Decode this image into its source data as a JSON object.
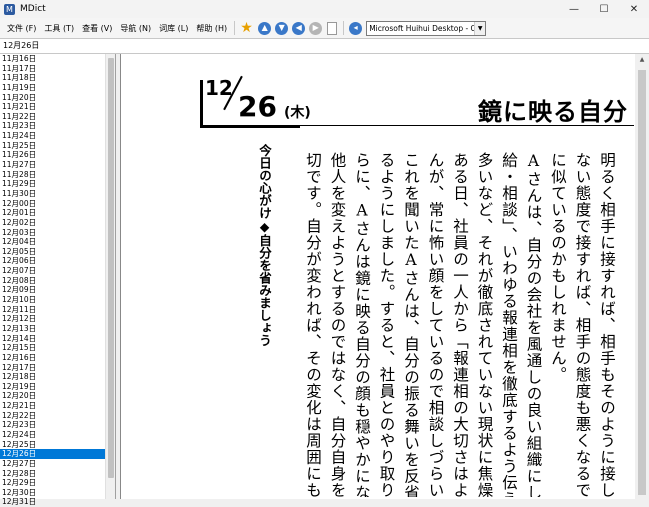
{
  "window": {
    "title": "MDict",
    "minimize": "—",
    "maximize": "☐",
    "close": "✕"
  },
  "menu": [
    {
      "label": "文件",
      "key": "(F)"
    },
    {
      "label": "工具",
      "key": "(T)"
    },
    {
      "label": "查看",
      "key": "(V)"
    },
    {
      "label": "导航",
      "key": "(N)"
    },
    {
      "label": "词库",
      "key": "(L)"
    },
    {
      "label": "帮助",
      "key": "(H)"
    }
  ],
  "toolbar": {
    "star": "★",
    "up": "▲",
    "down": "▼",
    "back": "◀",
    "forward": "▶",
    "font_select": "Microsoft Huihui Desktop - C",
    "font_arrow": "▼"
  },
  "headword": "12月26日",
  "word_list": {
    "items": [
      "11月16日",
      "11月17日",
      "11月18日",
      "11月19日",
      "11月20日",
      "11月21日",
      "11月22日",
      "11月23日",
      "11月24日",
      "11月25日",
      "11月26日",
      "11月27日",
      "11月28日",
      "11月29日",
      "11月30日",
      "12月00日",
      "12月01日",
      "12月02日",
      "12月03日",
      "12月04日",
      "12月05日",
      "12月06日",
      "12月07日",
      "12月08日",
      "12月09日",
      "12月10日",
      "12月11日",
      "12月12日",
      "12月13日",
      "12月14日",
      "12月15日",
      "12月16日",
      "12月17日",
      "12月18日",
      "12月19日",
      "12月20日",
      "12月21日",
      "12月22日",
      "12月23日",
      "12月24日",
      "12月25日",
      "12月26日",
      "12月27日",
      "12月28日",
      "12月29日",
      "12月30日",
      "12月31日"
    ],
    "selected_index": 41
  },
  "page": {
    "month": "12",
    "day": "26",
    "weekday": "(木)",
    "title": "鏡に映る自分",
    "subtitle": "今日の心がけ◆自分を省みましょう",
    "columns": [
      "明るく相手に接すれば、相手もそのように接してくれるでしょう。",
      "ない態度で接すれば、相手の態度も悪くなるでしょう。それは鏡に映",
      "に似ているのかもしれません。",
      "Aさんは、自分の会社を風通しの良い組織にしたいと思",
      "給・相談」、いわゆる報連相を徹底するよう伝えていました。しかし、",
      "多いなど、それが徹底されていない現状に焦燥を募らせていまし",
      "ある日、社員の一人から「報連相の大切さはよくわかっているので",
      "んが、常に怖い顔をしているので相談しづらいです」と言われまし",
      "これを聞いたAさんは、自分の振る舞いを反省し、柔らかい表情",
      "るようにしました。すると、社員とのやり取りの状況が改善してい",
      "らに、Aさんは鏡に映る自分の顔も穏やかになっていたことを実感し",
      "他人を変えようとするのではなく、自分自身を見つめ直し、改善す",
      "切です。自分が変われば、その変化は周囲にも影響を与えるでしょう"
    ]
  }
}
